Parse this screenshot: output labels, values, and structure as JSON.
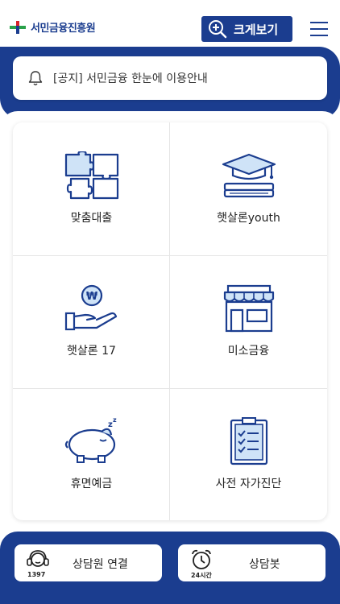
{
  "header": {
    "logo_text": "서민금융진흥원",
    "zoom_label": "크게보기"
  },
  "notice": {
    "text": "[공지] 서민금융 한눈에 이용안내"
  },
  "menu": [
    {
      "label": "맞춤대출",
      "icon": "puzzle-icon"
    },
    {
      "label": "햇살론youth",
      "icon": "graduation-cap-icon"
    },
    {
      "label": "햇살론 17",
      "icon": "won-coin-hand-icon"
    },
    {
      "label": "미소금융",
      "icon": "store-icon"
    },
    {
      "label": "휴면예금",
      "icon": "piggy-bank-icon"
    },
    {
      "label": "사전 자가진단",
      "icon": "clipboard-checklist-icon"
    }
  ],
  "footer": {
    "counsel_label": "상담원 연결",
    "counsel_number": "1397",
    "bot_label": "상담봇",
    "bot_sub": "24시간"
  },
  "colors": {
    "brand": "#1b3d8f",
    "accent_light": "#cfe3f7"
  }
}
